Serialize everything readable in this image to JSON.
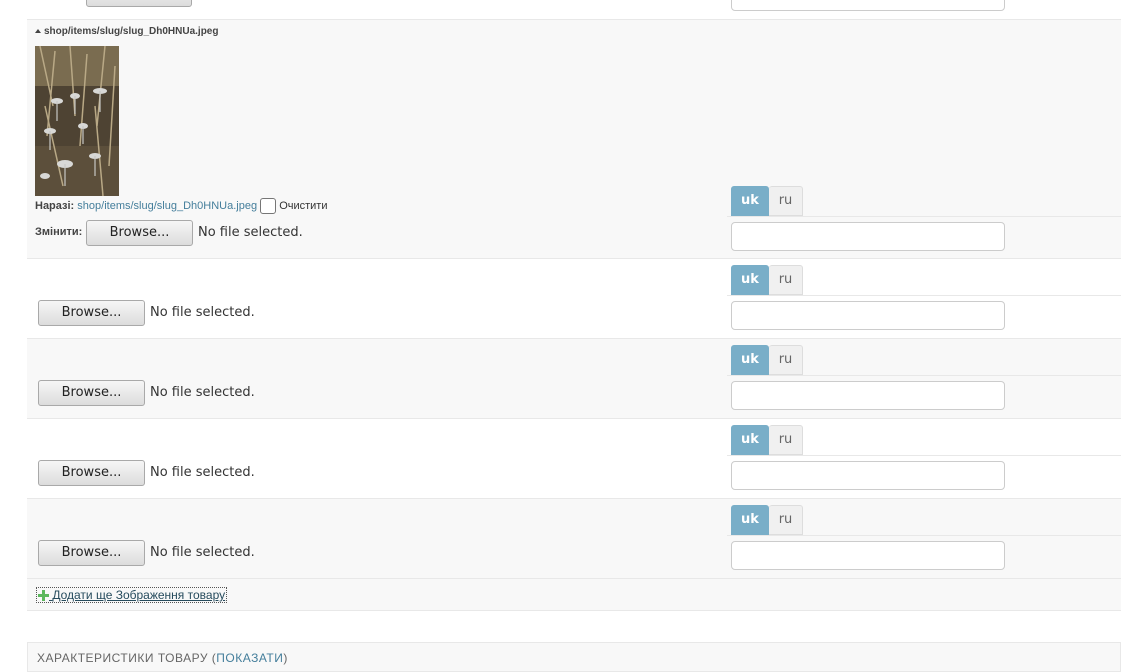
{
  "existing_image": {
    "path_label": "shop/items/slug/slug_Dh0HNUa.jpeg",
    "current_label": "Наразі:",
    "current_link": "shop/items/slug/slug_Dh0HNUa.jpeg",
    "clear_label": "Очистити",
    "change_label": "Змінити:",
    "browse_label": "Browse...",
    "no_file_text": "No file selected.",
    "colors": [
      "#8a7a5a",
      "#5d4f3a",
      "#c9c7c2",
      "#3a3a36"
    ]
  },
  "language_tabs": {
    "active": "uk",
    "inactive": "ru"
  },
  "upload_rows": [
    {
      "browse_label": "Browse...",
      "no_file_text": "No file selected."
    },
    {
      "browse_label": "Browse...",
      "no_file_text": "No file selected."
    },
    {
      "browse_label": "Browse...",
      "no_file_text": "No file selected."
    },
    {
      "browse_label": "Browse...",
      "no_file_text": "No file selected."
    }
  ],
  "add_another_label": "Додати ще Зображення товару",
  "characteristics": {
    "title": "ХАРАКТЕРИСТИКИ ТОВАРУ (",
    "toggle_label": "ПОКАЗАТИ",
    "close": ")"
  },
  "colors": {
    "tab_active": "#79aec8",
    "link": "#447e9b",
    "add_icon": "#5cb85c",
    "row_alt": "#f8f8f8"
  }
}
